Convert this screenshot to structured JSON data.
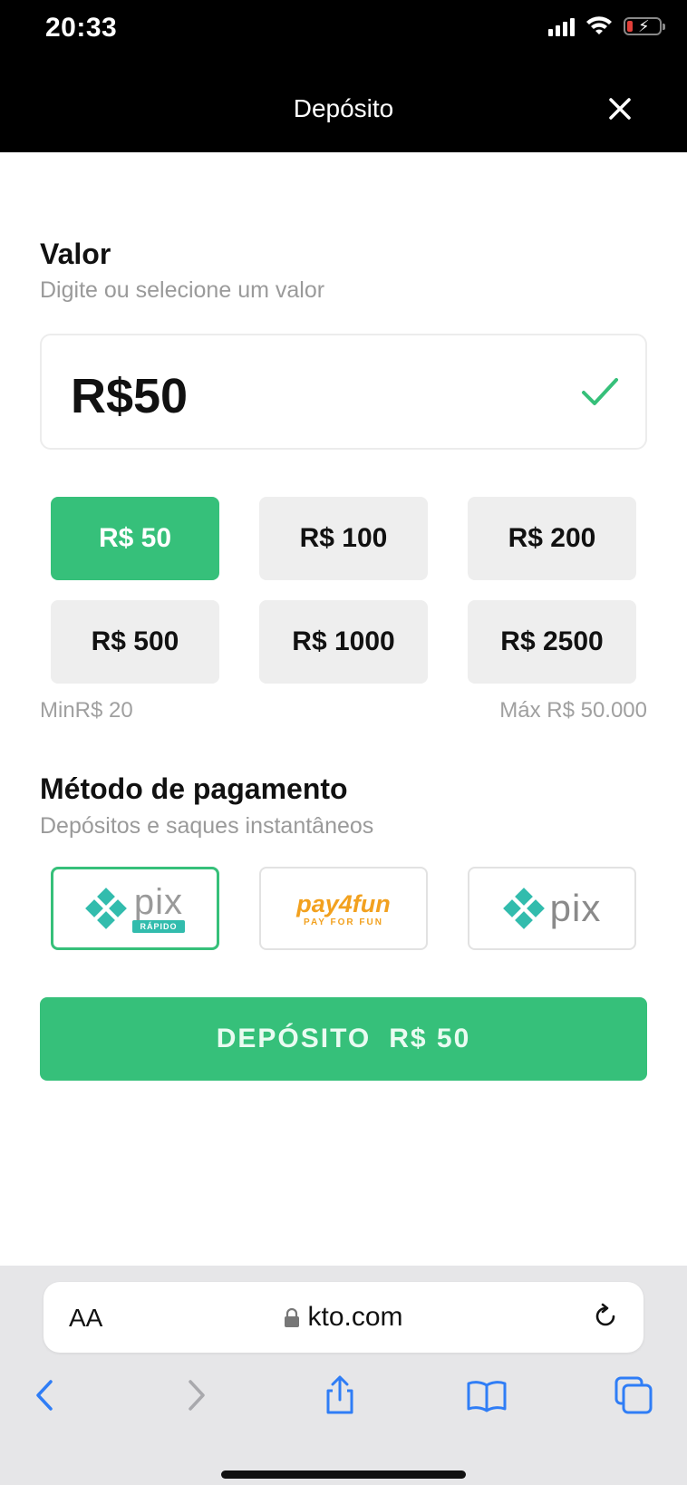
{
  "status_bar": {
    "time": "20:33"
  },
  "header": {
    "title": "Depósito"
  },
  "value_section": {
    "title": "Valor",
    "subtitle": "Digite ou selecione um valor",
    "amount": "R$50"
  },
  "quick_amounts": [
    {
      "label": "R$ 50",
      "active": true
    },
    {
      "label": "R$ 100",
      "active": false
    },
    {
      "label": "R$ 200",
      "active": false
    },
    {
      "label": "R$ 500",
      "active": false
    },
    {
      "label": "R$ 1000",
      "active": false
    },
    {
      "label": "R$ 2500",
      "active": false
    }
  ],
  "limits": {
    "min": "MinR$ 20",
    "max": "Máx R$ 50.000"
  },
  "payment_section": {
    "title": "Método de pagamento",
    "subtitle": "Depósitos e saques instantâneos",
    "methods": [
      {
        "logo_text": "pix",
        "tag": "RÁPIDO",
        "selected": true
      },
      {
        "logo_text": "pay4fun",
        "tag": "PAY FOR FUN",
        "selected": false
      },
      {
        "logo_text": "pix",
        "selected": false
      }
    ]
  },
  "deposit_button": {
    "label": "DEPÓSITO",
    "amount": "R$ 50"
  },
  "browser": {
    "text_size": "AA",
    "url": "kto.com"
  },
  "colors": {
    "accent": "#36c07a",
    "header_bg": "#000000",
    "chip_bg": "#eeeeee",
    "pay4fun_orange": "#f2a11f",
    "pix_teal": "#32bcad"
  },
  "icons": [
    "close-icon",
    "check-icon",
    "lock-icon",
    "reload-icon",
    "back-icon",
    "forward-icon",
    "share-icon",
    "bookmarks-icon",
    "tabs-icon"
  ]
}
